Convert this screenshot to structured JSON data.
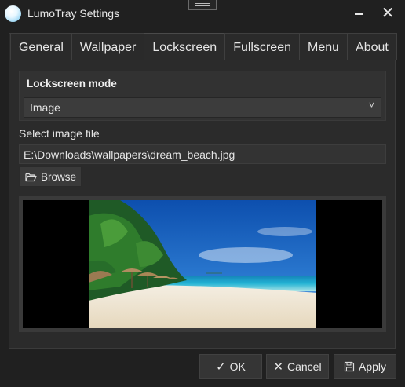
{
  "window": {
    "title": "LumoTray Settings",
    "minimize_icon": "minimize-icon",
    "close_icon": "close-icon"
  },
  "tabs": [
    {
      "label": "General"
    },
    {
      "label": "Wallpaper"
    },
    {
      "label": "Lockscreen",
      "active": true
    },
    {
      "label": "Fullscreen"
    },
    {
      "label": "Menu"
    },
    {
      "label": "About"
    }
  ],
  "lockscreen": {
    "mode_heading": "Lockscreen mode",
    "mode_value": "Image",
    "file_label": "Select image file",
    "file_path": "E:\\Downloads\\wallpapers\\dream_beach.jpg",
    "browse_label": "Browse"
  },
  "footer": {
    "ok_label": "OK",
    "cancel_label": "Cancel",
    "apply_label": "Apply"
  },
  "colors": {
    "background": "#202020",
    "panel": "#2b2b2b",
    "sea": "#1fa3c8",
    "sand": "#efe6d3"
  }
}
